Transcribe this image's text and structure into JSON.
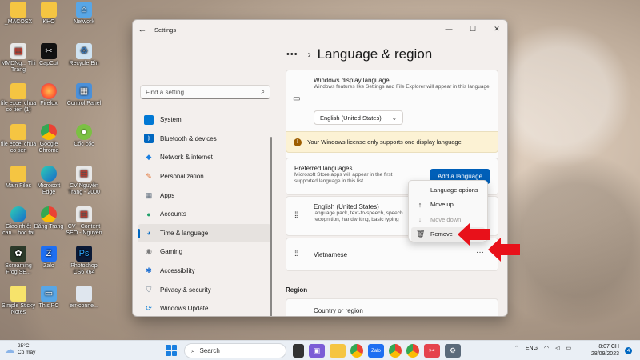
{
  "desktop": {
    "icons": [
      {
        "label": "_MACOSX",
        "icon": "folder-icon"
      },
      {
        "label": "KHO",
        "icon": "folder-icon"
      },
      {
        "label": "Network",
        "icon": "network-icon"
      },
      {
        "label": "MMDNg... Thi Trang",
        "icon": "pdf-icon"
      },
      {
        "label": "CapCut",
        "icon": "capcut-icon"
      },
      {
        "label": "Recycle Bin",
        "icon": "recycle-bin-icon"
      },
      {
        "label": "file excel chua co tien (1)",
        "icon": "folder-icon"
      },
      {
        "label": "Firefox",
        "icon": "firefox-icon"
      },
      {
        "label": "Control Panel",
        "icon": "control-panel-icon"
      },
      {
        "label": "file excel chua co tien",
        "icon": "folder-icon"
      },
      {
        "label": "Google Chrome",
        "icon": "chrome-icon"
      },
      {
        "label": "Cốc cốc",
        "icon": "coccoc-icon"
      },
      {
        "label": "Main Files",
        "icon": "folder-icon"
      },
      {
        "label": "Microsoft Edge",
        "icon": "edge-icon"
      },
      {
        "label": "CV Nguyễn Trang - 2000",
        "icon": "pdf-icon"
      },
      {
        "label": "Giao nhiệt can... hoc tai",
        "icon": "edge-icon"
      },
      {
        "label": "Đăng Trang",
        "icon": "chrome-icon"
      },
      {
        "label": "CV - Content SEO - Nguyễn",
        "icon": "pdf-icon"
      },
      {
        "label": "Screaming Frog SE...",
        "icon": "frog-icon"
      },
      {
        "label": "Zalo",
        "icon": "zalo-icon"
      },
      {
        "label": "Photoshop CS6 x64",
        "icon": "photoshop-icon"
      },
      {
        "label": "Simple Sticky Notes",
        "icon": "sticky-notes-icon"
      },
      {
        "label": "This PC",
        "icon": "this-pc-icon"
      },
      {
        "label": "err-conne...",
        "icon": "image-icon"
      }
    ]
  },
  "window": {
    "title": "Settings",
    "controls": {
      "minimize": "—",
      "maximize": "☐",
      "close": "✕"
    }
  },
  "search": {
    "placeholder": "Find a setting"
  },
  "nav": {
    "items": [
      {
        "label": "System",
        "icon": "system-icon",
        "color": "#0078d4",
        "active": false
      },
      {
        "label": "Bluetooth & devices",
        "icon": "bluetooth-icon",
        "color": "#0067c0",
        "active": false
      },
      {
        "label": "Network & internet",
        "icon": "wifi-icon",
        "color": "#1a7fe0",
        "active": false
      },
      {
        "label": "Personalization",
        "icon": "brush-icon",
        "color": "#e06c2a",
        "active": false
      },
      {
        "label": "Apps",
        "icon": "apps-icon",
        "color": "#5b6a7a",
        "active": false
      },
      {
        "label": "Accounts",
        "icon": "person-icon",
        "color": "#22a06b",
        "active": false
      },
      {
        "label": "Time & language",
        "icon": "globe-icon",
        "color": "#0a6cc4",
        "active": true
      },
      {
        "label": "Gaming",
        "icon": "gamepad-icon",
        "color": "#7a7a7a",
        "active": false
      },
      {
        "label": "Accessibility",
        "icon": "accessibility-icon",
        "color": "#1e6fd1",
        "active": false
      },
      {
        "label": "Privacy & security",
        "icon": "shield-icon",
        "color": "#7a8896",
        "active": false
      },
      {
        "label": "Windows Update",
        "icon": "update-icon",
        "color": "#0078d4",
        "active": false
      }
    ]
  },
  "breadcrumb": {
    "more": "•••",
    "chevron": "›",
    "title": "Language & region"
  },
  "display_language": {
    "title": "Windows display language",
    "subtitle": "Windows features like Settings and File Explorer will appear in this language",
    "selected": "English (United States)"
  },
  "warning": {
    "text": "Your Windows license only supports one display language"
  },
  "preferred": {
    "title": "Preferred languages",
    "subtitle": "Microsoft Store apps will appear in the first supported language in this list",
    "add_button": "Add a language"
  },
  "languages": [
    {
      "name": "English (United States)",
      "details": "language pack, text-to-speech, speech recognition, handwriting, basic typing"
    },
    {
      "name": "Vietnamese",
      "details": ""
    }
  ],
  "context_menu": {
    "items": [
      {
        "label": "Language options",
        "icon": "more-icon",
        "glyph": "···",
        "disabled": false
      },
      {
        "label": "Move up",
        "icon": "arrow-up-icon",
        "glyph": "↑",
        "disabled": false
      },
      {
        "label": "Move down",
        "icon": "arrow-down-icon",
        "glyph": "↓",
        "disabled": true
      },
      {
        "label": "Remove",
        "icon": "trash-icon",
        "glyph": "🗑",
        "disabled": false
      }
    ]
  },
  "region": {
    "section": "Region",
    "country_label": "Country or region"
  },
  "taskbar": {
    "weather": {
      "temp": "25°C",
      "condition": "Có mây"
    },
    "search_label": "Search",
    "tray": {
      "lang": "ENG"
    },
    "clock": {
      "time": "8:07 CH",
      "date": "28/09/2023"
    },
    "notifications": "4"
  },
  "colors": {
    "accent": "#005fb8",
    "warning_bg": "#fcf2d4",
    "arrow": "#e8111a"
  }
}
